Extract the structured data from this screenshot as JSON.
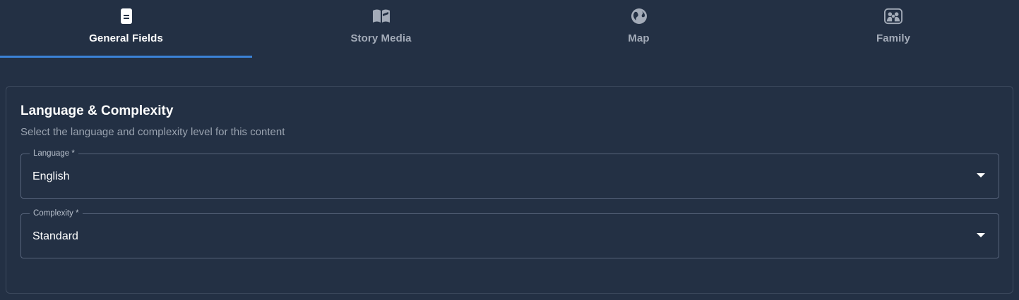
{
  "tabs": [
    {
      "label": "General Fields",
      "icon": "document-icon",
      "active": true
    },
    {
      "label": "Story Media",
      "icon": "book-icon",
      "active": false
    },
    {
      "label": "Map",
      "icon": "globe-icon",
      "active": false
    },
    {
      "label": "Family",
      "icon": "family-icon",
      "active": false
    }
  ],
  "section": {
    "title": "Language & Complexity",
    "subtitle": "Select the language and complexity level for this content"
  },
  "fields": {
    "language": {
      "label": "Language *",
      "value": "English"
    },
    "complexity": {
      "label": "Complexity *",
      "value": "Standard"
    }
  },
  "colors": {
    "background": "#233044",
    "accent": "#3b82d6",
    "border": "#56637a"
  }
}
